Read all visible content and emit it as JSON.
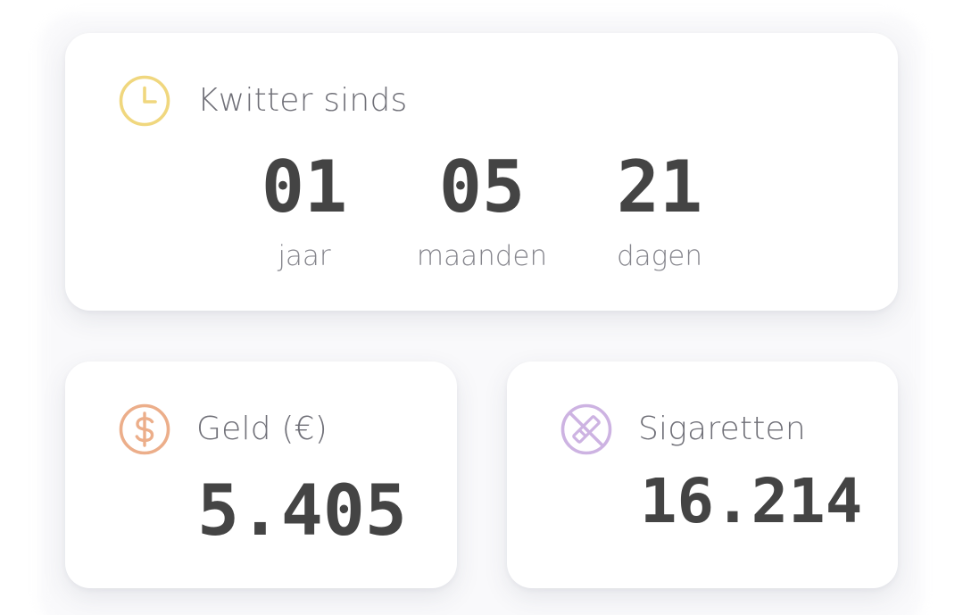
{
  "quit_since": {
    "title": "Kwitter sinds",
    "icon": "clock-icon",
    "icon_color": "#f0d77e",
    "counters": [
      {
        "value": "01",
        "unit": "jaar"
      },
      {
        "value": "05",
        "unit": "maanden"
      },
      {
        "value": "21",
        "unit": "dagen"
      }
    ]
  },
  "money": {
    "title": "Geld (€)",
    "icon": "dollar-icon",
    "icon_color": "#ecae8a",
    "value": "5.405"
  },
  "cigarettes": {
    "title": "Sigaretten",
    "icon": "no-smoking-icon",
    "icon_color": "#cdb3e2",
    "value": "16.214"
  }
}
